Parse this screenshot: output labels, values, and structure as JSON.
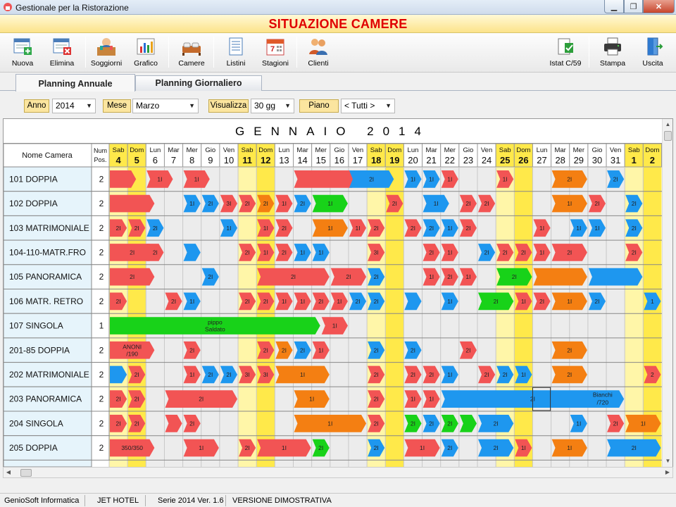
{
  "window": {
    "title": "Gestionale per la Ristorazione"
  },
  "banner": "SITUAZIONE CAMERE",
  "toolbar": [
    {
      "label": "Nuova",
      "icon": "new-icon"
    },
    {
      "label": "Elimina",
      "icon": "delete-icon"
    },
    {
      "label": "Soggiorni",
      "icon": "guests-icon"
    },
    {
      "label": "Grafico",
      "icon": "chart-icon"
    },
    {
      "label": "Camere",
      "icon": "rooms-icon"
    },
    {
      "label": "Listini",
      "icon": "pricelist-icon"
    },
    {
      "label": "Stagioni",
      "icon": "calendar-icon"
    },
    {
      "label": "Clienti",
      "icon": "clients-icon"
    },
    {
      "label": "Istat C/59",
      "icon": "istat-icon"
    },
    {
      "label": "Stampa",
      "icon": "printer-icon"
    },
    {
      "label": "Uscita",
      "icon": "exit-icon"
    }
  ],
  "tabs": [
    {
      "label": "Planning Annuale",
      "active": true
    },
    {
      "label": "Planning Giornaliero",
      "active": false
    }
  ],
  "filters": {
    "anno_label": "Anno",
    "anno_value": "2014",
    "mese_label": "Mese",
    "mese_value": "Marzo",
    "visualizza_label": "Visualizza",
    "visualizza_value": "30 gg",
    "piano_label": "Piano",
    "piano_value": "< Tutti >"
  },
  "grid": {
    "month_title": "GENNAIO 2014",
    "col_room": "Nome Camera",
    "col_pos": [
      "Num",
      "Pos."
    ],
    "days": [
      {
        "d": "Sab",
        "n": "4",
        "w": "sat"
      },
      {
        "d": "Dom",
        "n": "5",
        "w": "sun"
      },
      {
        "d": "Lun",
        "n": "6"
      },
      {
        "d": "Mar",
        "n": "7"
      },
      {
        "d": "Mer",
        "n": "8"
      },
      {
        "d": "Gio",
        "n": "9"
      },
      {
        "d": "Ven",
        "n": "10"
      },
      {
        "d": "Sab",
        "n": "11",
        "w": "sat"
      },
      {
        "d": "Dom",
        "n": "12",
        "w": "sun"
      },
      {
        "d": "Lun",
        "n": "13"
      },
      {
        "d": "Mar",
        "n": "14"
      },
      {
        "d": "Mer",
        "n": "15"
      },
      {
        "d": "Gio",
        "n": "16"
      },
      {
        "d": "Ven",
        "n": "17"
      },
      {
        "d": "Sab",
        "n": "18",
        "w": "sat"
      },
      {
        "d": "Dom",
        "n": "19",
        "w": "sun"
      },
      {
        "d": "Lun",
        "n": "20"
      },
      {
        "d": "Mar",
        "n": "21"
      },
      {
        "d": "Mer",
        "n": "22"
      },
      {
        "d": "Gio",
        "n": "23"
      },
      {
        "d": "Ven",
        "n": "24"
      },
      {
        "d": "Sab",
        "n": "25",
        "w": "sat"
      },
      {
        "d": "Dom",
        "n": "26",
        "w": "sun"
      },
      {
        "d": "Lun",
        "n": "27"
      },
      {
        "d": "Mar",
        "n": "28"
      },
      {
        "d": "Mer",
        "n": "29"
      },
      {
        "d": "Gio",
        "n": "30"
      },
      {
        "d": "Ven",
        "n": "31"
      },
      {
        "d": "Sab",
        "n": "1",
        "w": "sat"
      },
      {
        "d": "Dom",
        "n": "2",
        "w": "sun"
      }
    ],
    "rooms": [
      {
        "name": "101 DOPPIA",
        "pos": "2",
        "b": [
          [
            0,
            1.5,
            "r",
            ""
          ],
          [
            2,
            1.5,
            "r",
            "1I"
          ],
          [
            4,
            1.5,
            "r",
            "1I"
          ],
          [
            10,
            3.5,
            "r",
            ""
          ],
          [
            13,
            2.5,
            "b",
            "2I"
          ],
          [
            16,
            1,
            "b",
            "1I"
          ],
          [
            17,
            1,
            "b",
            "1I"
          ],
          [
            18,
            1,
            "r",
            "1I"
          ],
          [
            21,
            1,
            "r",
            "1I"
          ],
          [
            24,
            2,
            "o",
            "2I"
          ],
          [
            27,
            1,
            "b",
            "2I"
          ]
        ]
      },
      {
        "name": "102 DOPPIA",
        "pos": "2",
        "b": [
          [
            0,
            2.5,
            "r",
            ""
          ],
          [
            4,
            1,
            "b",
            "1I"
          ],
          [
            5,
            1,
            "b",
            "2I"
          ],
          [
            6,
            1,
            "r",
            "3I"
          ],
          [
            7,
            1,
            "r",
            "2I"
          ],
          [
            8,
            1,
            "o",
            "2I"
          ],
          [
            9,
            1,
            "r",
            "1I"
          ],
          [
            10,
            1,
            "b",
            "2I"
          ],
          [
            11,
            2,
            "g",
            "1I"
          ],
          [
            15,
            1,
            "r",
            "2I"
          ],
          [
            17,
            1.5,
            "b",
            "1I"
          ],
          [
            19,
            1,
            "r",
            "2I"
          ],
          [
            20,
            1,
            "r",
            "2I"
          ],
          [
            24,
            2,
            "o",
            "1I"
          ],
          [
            26,
            1,
            "r",
            "2I"
          ],
          [
            28,
            1,
            "b",
            "2I"
          ]
        ]
      },
      {
        "name": "103 MATRIMONIALE",
        "pos": "2",
        "b": [
          [
            0,
            1,
            "r",
            "2I"
          ],
          [
            1,
            1,
            "r",
            "2I"
          ],
          [
            2,
            1,
            "b",
            "2I"
          ],
          [
            6,
            1,
            "b",
            "1I"
          ],
          [
            8,
            1,
            "r",
            "1I"
          ],
          [
            9,
            1,
            "r",
            "2I"
          ],
          [
            11,
            2,
            "o",
            "1I"
          ],
          [
            13,
            1,
            "r",
            "1I"
          ],
          [
            14,
            1,
            "r",
            "2I"
          ],
          [
            16,
            1,
            "r",
            "2I"
          ],
          [
            17,
            1,
            "b",
            "2I"
          ],
          [
            18,
            1,
            "b",
            "1I"
          ],
          [
            19,
            1,
            "r",
            "2I"
          ],
          [
            23,
            1,
            "r",
            "1I"
          ],
          [
            25,
            1,
            "b",
            "1I"
          ],
          [
            26,
            1,
            "b",
            "1I"
          ],
          [
            28,
            1,
            "b",
            "2I"
          ]
        ]
      },
      {
        "name": "104-110-MATR.FRO",
        "pos": "2",
        "b": [
          [
            0,
            2.5,
            "r",
            "2I"
          ],
          [
            2,
            1,
            "r",
            "2I"
          ],
          [
            4,
            1,
            "b",
            ""
          ],
          [
            7,
            1,
            "r",
            "2I"
          ],
          [
            8,
            1,
            "r",
            "1I"
          ],
          [
            9,
            1,
            "r",
            "2I"
          ],
          [
            10,
            1,
            "b",
            "1I"
          ],
          [
            11,
            1,
            "b",
            "1I"
          ],
          [
            14,
            1,
            "r",
            "3I"
          ],
          [
            17,
            1,
            "r",
            "2I"
          ],
          [
            18,
            1,
            "r",
            "1I"
          ],
          [
            20,
            1,
            "b",
            "2I"
          ],
          [
            21,
            1,
            "r",
            "2I"
          ],
          [
            22,
            1,
            "r",
            "2I"
          ],
          [
            23,
            1,
            "r",
            "1I"
          ],
          [
            24,
            2,
            "r",
            "2I"
          ],
          [
            28,
            1,
            "r",
            "2I"
          ]
        ]
      },
      {
        "name": "105 PANORAMICA",
        "pos": "2",
        "b": [
          [
            0,
            2.5,
            "r",
            "2I"
          ],
          [
            5,
            1,
            "b",
            "2I"
          ],
          [
            8,
            4,
            "r",
            "2I"
          ],
          [
            12,
            2,
            "r",
            "2I"
          ],
          [
            14,
            1,
            "b",
            "2I"
          ],
          [
            17,
            1,
            "r",
            "1I"
          ],
          [
            18,
            1,
            "r",
            "2I"
          ],
          [
            19,
            1,
            "r",
            "1I"
          ],
          [
            21,
            2,
            "g",
            "2I"
          ],
          [
            23,
            3,
            "o",
            ""
          ],
          [
            26,
            3,
            "b",
            ""
          ]
        ]
      },
      {
        "name": "106 MATR. RETRO",
        "pos": "2",
        "b": [
          [
            0,
            1,
            "r",
            "2I"
          ],
          [
            3,
            1,
            "r",
            "2I"
          ],
          [
            4,
            1,
            "b",
            "1I"
          ],
          [
            7,
            1,
            "r",
            "2I"
          ],
          [
            8,
            1,
            "r",
            "2I"
          ],
          [
            9,
            1,
            "r",
            "1I"
          ],
          [
            10,
            1,
            "r",
            "1I"
          ],
          [
            11,
            1,
            "r",
            "2I"
          ],
          [
            12,
            1,
            "r",
            "1I"
          ],
          [
            13,
            1,
            "b",
            "2I"
          ],
          [
            14,
            1,
            "b",
            "2I"
          ],
          [
            16,
            1,
            "b",
            ""
          ],
          [
            18,
            1,
            "b",
            "1I"
          ],
          [
            20,
            2,
            "g",
            "2I"
          ],
          [
            22,
            1,
            "r",
            "1I"
          ],
          [
            23,
            1,
            "r",
            "2I"
          ],
          [
            24,
            2,
            "o",
            "1I"
          ],
          [
            26,
            1,
            "b",
            "2I"
          ],
          [
            29,
            1,
            "b",
            "1"
          ]
        ]
      },
      {
        "name": "107 SINGOLA",
        "pos": "1",
        "b": [
          [
            0,
            11.5,
            "g",
            "pippo|Saldato"
          ],
          [
            11.5,
            1.5,
            "r",
            "1I"
          ]
        ]
      },
      {
        "name": "201-85 DOPPIA",
        "pos": "2",
        "b": [
          [
            0,
            2.5,
            "r",
            "ANONI|/190"
          ],
          [
            4,
            1,
            "r",
            "2I"
          ],
          [
            8,
            1,
            "r",
            "2I"
          ],
          [
            9,
            1,
            "o",
            "2I"
          ],
          [
            10,
            1,
            "b",
            "2I"
          ],
          [
            11,
            1,
            "r",
            "1I"
          ],
          [
            14,
            1,
            "b",
            "2I"
          ],
          [
            16,
            1,
            "b",
            "2I"
          ],
          [
            19,
            1,
            "r",
            "2I"
          ],
          [
            24,
            2,
            "o",
            "2I"
          ]
        ]
      },
      {
        "name": "202 MATRIMONIALE",
        "pos": "2",
        "b": [
          [
            0,
            1,
            "b",
            ""
          ],
          [
            1,
            1,
            "r",
            "2I"
          ],
          [
            4,
            1,
            "r",
            "1I"
          ],
          [
            5,
            1,
            "b",
            "2I"
          ],
          [
            6,
            1,
            "b",
            "2I"
          ],
          [
            7,
            1,
            "r",
            "3I"
          ],
          [
            8,
            1,
            "r",
            "3I"
          ],
          [
            9,
            3,
            "o",
            "1I"
          ],
          [
            14,
            1,
            "r",
            "2I"
          ],
          [
            16,
            1,
            "r",
            "2I"
          ],
          [
            17,
            1,
            "r",
            "2I"
          ],
          [
            18,
            1,
            "b",
            "1I"
          ],
          [
            20,
            1,
            "r",
            "2I"
          ],
          [
            21,
            1,
            "b",
            "2I"
          ],
          [
            22,
            1,
            "b",
            "1I"
          ],
          [
            24,
            2,
            "o",
            "2I"
          ],
          [
            29,
            1,
            "r",
            "2"
          ]
        ]
      },
      {
        "name": "203 PANORAMICA",
        "pos": "2",
        "b": [
          [
            0,
            1,
            "r",
            "2I"
          ],
          [
            1,
            1,
            "r",
            "2I"
          ],
          [
            3,
            4,
            "r",
            "2I"
          ],
          [
            10,
            2,
            "o",
            "1I"
          ],
          [
            14,
            1,
            "r",
            "2I"
          ],
          [
            16,
            1,
            "r",
            "1I"
          ],
          [
            17,
            1,
            "r",
            "1I"
          ],
          [
            18,
            10,
            "b",
            "2I"
          ]
        ]
      },
      {
        "name": "204 SINGOLA",
        "pos": "2",
        "b": [
          [
            0,
            1,
            "r",
            "2I"
          ],
          [
            1,
            1,
            "r",
            "2I"
          ],
          [
            3,
            1,
            "r",
            ""
          ],
          [
            4,
            1,
            "r",
            "2I"
          ],
          [
            10,
            4,
            "o",
            "1I"
          ],
          [
            14,
            1,
            "r",
            "2I"
          ],
          [
            16,
            1,
            "g",
            "2I"
          ],
          [
            17,
            1,
            "b",
            "2I"
          ],
          [
            18,
            1,
            "g",
            "2I"
          ],
          [
            19,
            1,
            "g",
            ""
          ],
          [
            20,
            2,
            "b",
            "2I"
          ],
          [
            25,
            1,
            "b",
            "1I"
          ],
          [
            27,
            1,
            "r",
            "2I"
          ],
          [
            28,
            2,
            "o",
            "1I"
          ]
        ]
      },
      {
        "name": "205 DOPPIA",
        "pos": "2",
        "b": [
          [
            0,
            2.5,
            "r",
            "350/350"
          ],
          [
            4,
            2,
            "r",
            "1I"
          ],
          [
            7,
            1,
            "r",
            "2I"
          ],
          [
            8,
            3,
            "r",
            "1I"
          ],
          [
            11,
            1,
            "g",
            "2I"
          ],
          [
            14,
            1,
            "b",
            "2I"
          ],
          [
            16,
            2,
            "r",
            "1I"
          ],
          [
            18,
            1,
            "b",
            "2I"
          ],
          [
            20,
            2,
            "b",
            "2I"
          ],
          [
            22,
            1,
            "r",
            "1I"
          ],
          [
            24,
            2,
            "o",
            "1I"
          ],
          [
            27,
            3,
            "b",
            "2I"
          ]
        ]
      }
    ],
    "label_bianchi": "Bianchi|/720"
  },
  "colors": {
    "red": "#f25454",
    "orange": "#f47f12",
    "blue": "#1e97ef",
    "green": "#18d219",
    "weekend_sat": "#fff6a8",
    "weekend_sun": "#ffe94a",
    "header_weekend": "#ffe94a",
    "row_head_bg": "#e6f4fb"
  },
  "status": [
    "GenioSoft Informatica",
    "JET HOTEL",
    "Serie 2014 Ver. 1.6",
    "VERSIONE DIMOSTRATIVA"
  ]
}
